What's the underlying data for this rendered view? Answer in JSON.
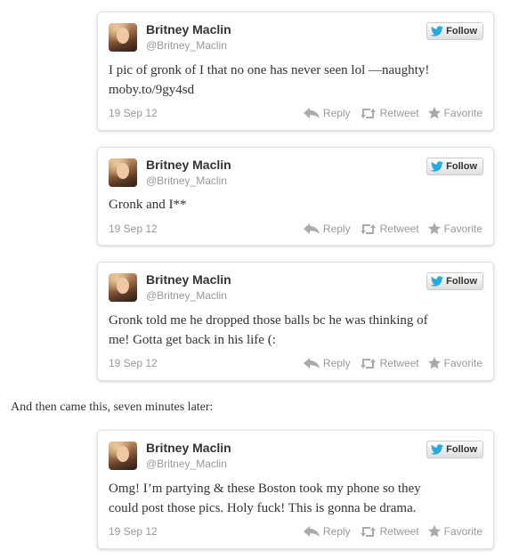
{
  "colors": {
    "bird_blue": "#2aa9e0",
    "text": "#333333",
    "muted": "#999999"
  },
  "narration": "And then came this, seven minutes later:",
  "tweets": [
    {
      "name": "Britney Maclin",
      "handle": "@Britney_Maclin",
      "follow_label": "Follow",
      "text": "I pic of gronk of I that no one has never seen lol —naughty!\nmoby.to/9gy4sd",
      "date": "19 Sep 12",
      "reply_label": "Reply",
      "retweet_label": "Retweet",
      "favorite_label": "Favorite"
    },
    {
      "name": "Britney Maclin",
      "handle": "@Britney_Maclin",
      "follow_label": "Follow",
      "text": "Gronk and I**",
      "date": "19 Sep 12",
      "reply_label": "Reply",
      "retweet_label": "Retweet",
      "favorite_label": "Favorite"
    },
    {
      "name": "Britney Maclin",
      "handle": "@Britney_Maclin",
      "follow_label": "Follow",
      "text": "Gronk told me he dropped those balls bc he was thinking of\nme! Gotta get back in his life (:",
      "date": "19 Sep 12",
      "reply_label": "Reply",
      "retweet_label": "Retweet",
      "favorite_label": "Favorite"
    },
    {
      "name": "Britney Maclin",
      "handle": "@Britney_Maclin",
      "follow_label": "Follow",
      "text": "Omg! I’m partying & these Boston took my phone so they\ncould post those pics. Holy fuck! This is gonna be drama.",
      "date": "19 Sep 12",
      "reply_label": "Reply",
      "retweet_label": "Retweet",
      "favorite_label": "Favorite"
    }
  ]
}
